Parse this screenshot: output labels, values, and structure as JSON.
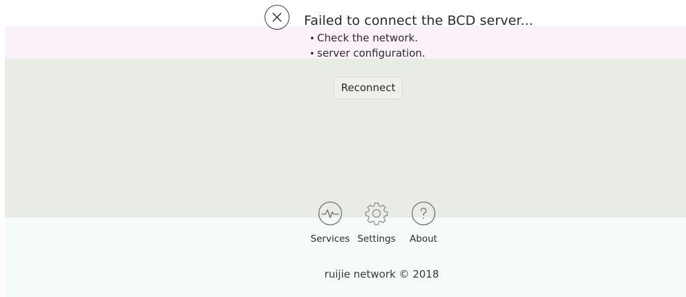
{
  "error": {
    "icon": "close-circle-icon",
    "title": "Failed to connect the BCD server..."
  },
  "hints": [
    "Check the network.",
    "server configuration."
  ],
  "actions": {
    "reconnect_label": "Reconnect"
  },
  "nav": {
    "services": {
      "label": "Services",
      "icon": "pulse-icon"
    },
    "settings": {
      "label": "Settings",
      "icon": "gear-icon"
    },
    "about": {
      "label": "About",
      "icon": "question-icon"
    }
  },
  "footer": {
    "text": "ruijie network © 2018"
  },
  "colors": {
    "pink_band": "#fbf1fb",
    "gray_band": "#e9ebe6",
    "mint_band": "#f4fbf8",
    "text": "#2b2b2b"
  }
}
